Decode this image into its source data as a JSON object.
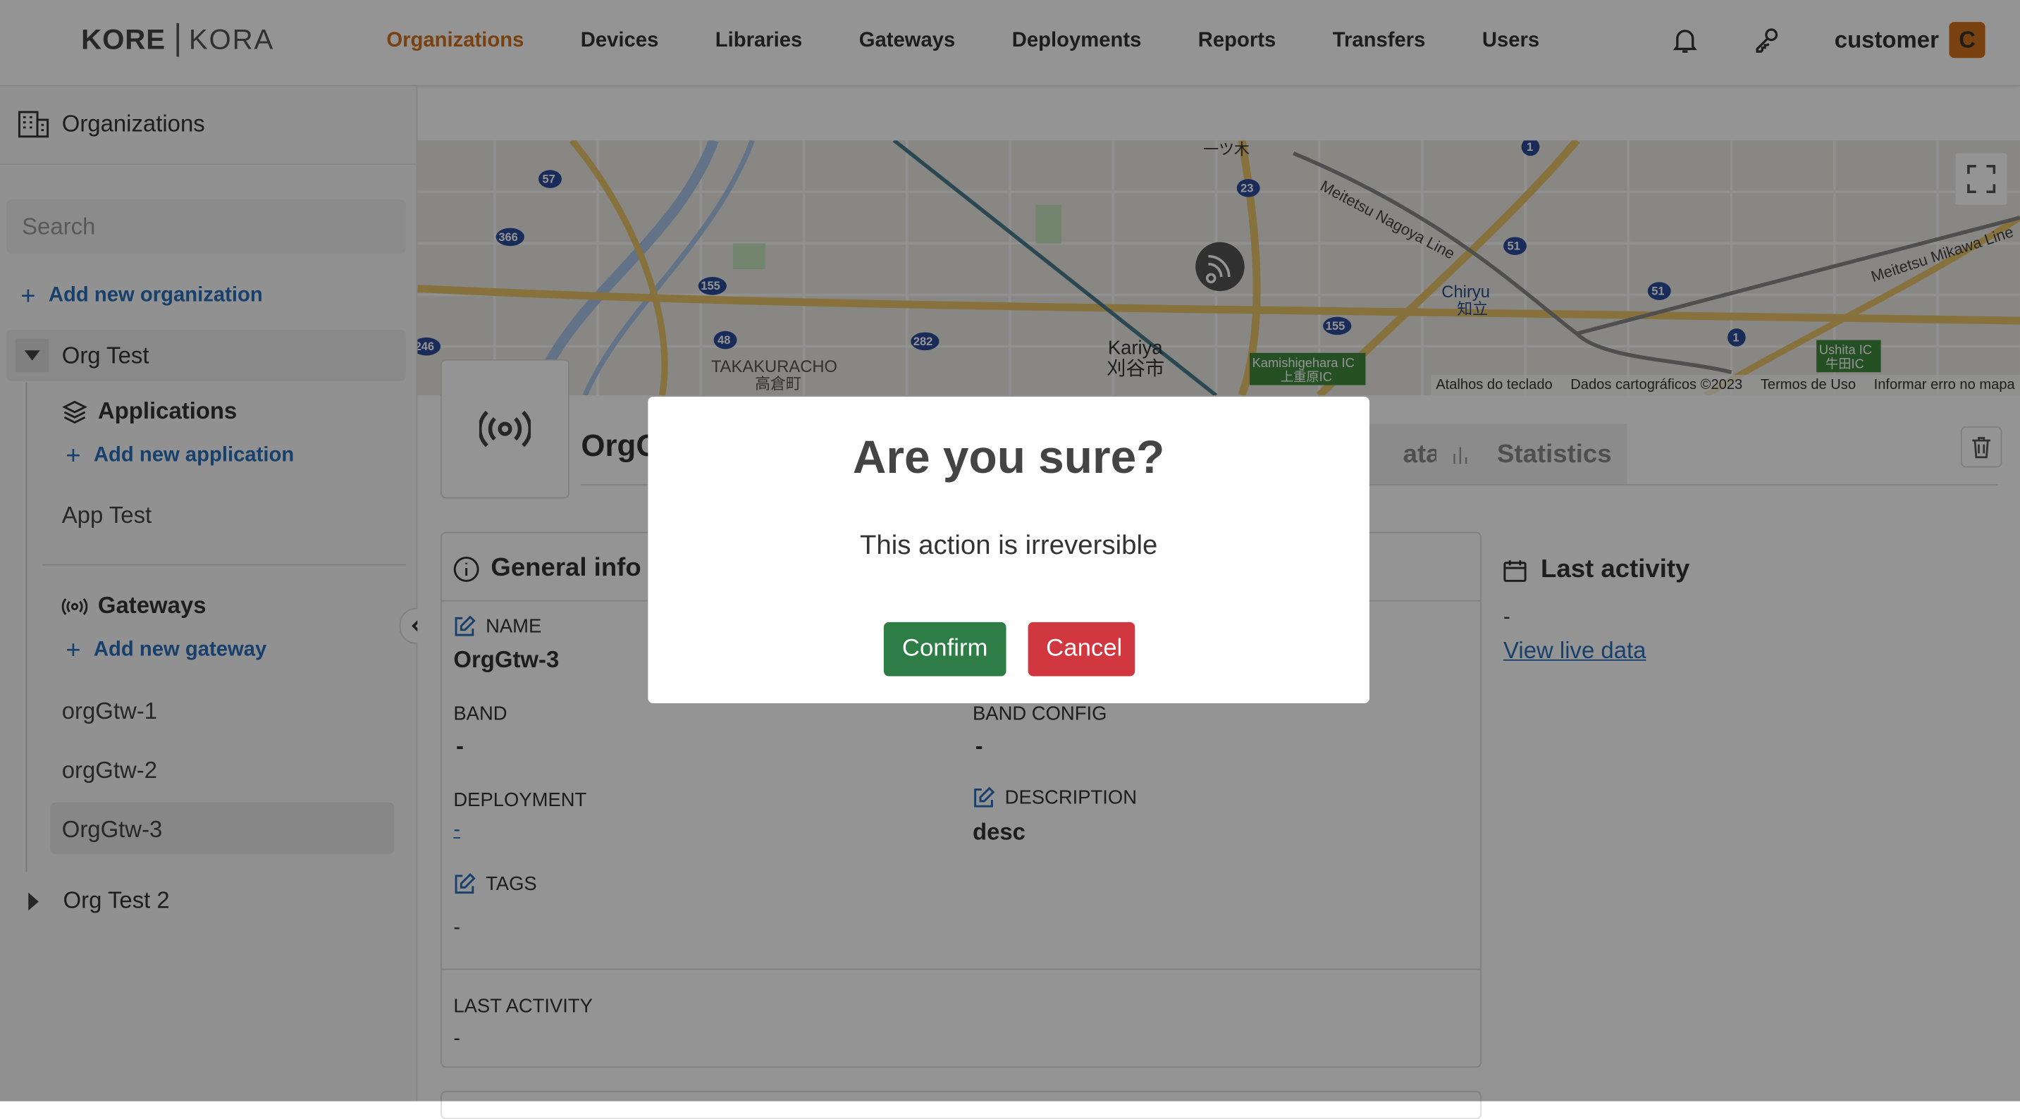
{
  "header": {
    "logo_kore": "KORE",
    "logo_kora": "KORA",
    "nav": [
      {
        "label": "Organizations",
        "active": true
      },
      {
        "label": "Devices"
      },
      {
        "label": "Libraries"
      },
      {
        "label": "Gateways"
      },
      {
        "label": "Deployments"
      },
      {
        "label": "Reports"
      },
      {
        "label": "Transfers"
      },
      {
        "label": "Users"
      }
    ],
    "user_name": "customer",
    "avatar_initial": "C",
    "accent_color": "#d2711d"
  },
  "sidebar": {
    "title": "Organizations",
    "search_placeholder": "Search",
    "add_org": "Add new organization",
    "org1": "Org Test",
    "applications_title": "Applications",
    "add_app": "Add new application",
    "app1": "App Test",
    "gateways_title": "Gateways",
    "add_gateway": "Add new gateway",
    "gateways": [
      "orgGtw-1",
      "orgGtw-2",
      "OrgGtw-3"
    ],
    "org2": "Org Test 2"
  },
  "map": {
    "labels": [
      "TAKAKURACHO",
      "高倉町",
      "Kariya",
      "刈谷市",
      "Chiryu",
      "知立",
      "Meitetsu Nagoya Line",
      "Meitetsu Mikawa Line",
      "Kamishigehara IC",
      "上重原IC",
      "Ushita IC",
      "牛田IC",
      "一ツ木"
    ],
    "road_numbers": [
      "57",
      "366",
      "155",
      "48",
      "282",
      "246",
      "23",
      "155",
      "51",
      "51",
      "1",
      "1"
    ],
    "attribution": [
      "Atalhos do teclado",
      "Dados cartográficos ©2023",
      "Termos de Uso",
      "Informar erro no mapa"
    ]
  },
  "gateway": {
    "title_partial": "OrgG",
    "tab_data_partial": "ata",
    "tab_statistics": "Statistics"
  },
  "general_info": {
    "title": "General info",
    "name_label": "NAME",
    "name_value": "OrgGtw-3",
    "band_label": "BAND",
    "band_value": "-",
    "band_config_label": "BAND CONFIG",
    "band_config_value": "-",
    "deployment_label": "DEPLOYMENT",
    "deployment_value": "-",
    "description_label": "DESCRIPTION",
    "description_value": "desc",
    "tags_label": "TAGS",
    "tags_value": "-",
    "last_activity_label": "LAST ACTIVITY",
    "last_activity_value": "-"
  },
  "last_activity": {
    "title": "Last activity",
    "value": "-",
    "link": "View live data"
  },
  "modal": {
    "title": "Are you sure?",
    "text": "This action is irreversible",
    "confirm": "Confirm",
    "cancel": "Cancel",
    "confirm_color": "#2e7d46",
    "cancel_color": "#d0373f"
  }
}
